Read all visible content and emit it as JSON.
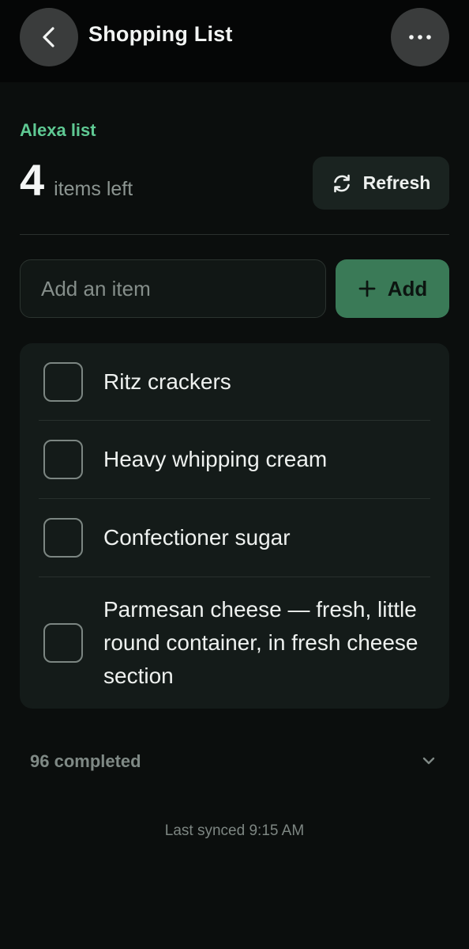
{
  "header": {
    "title": "Shopping List",
    "back_icon": "chevron-left-icon",
    "more_icon": "more-horizontal-icon"
  },
  "summary": {
    "list_name": "Alexa list",
    "count": "4",
    "count_label": "items left",
    "refresh_label": "Refresh"
  },
  "add_item": {
    "placeholder": "Add an item",
    "value": "",
    "button_label": "Add"
  },
  "items": [
    {
      "text": "Ritz crackers",
      "checked": false
    },
    {
      "text": "Heavy whipping cream",
      "checked": false
    },
    {
      "text": "Confectioner sugar",
      "checked": false
    },
    {
      "text": "Parmesan cheese — fresh, little round container, in fresh cheese section",
      "checked": false
    }
  ],
  "completed": {
    "label": "96 completed",
    "expanded": false
  },
  "sync": {
    "text": "Last synced 9:15 AM"
  },
  "colors": {
    "accent": "#5fc993",
    "add_button": "#3a7a57",
    "background": "#0b0e0d",
    "card": "#141b19"
  }
}
